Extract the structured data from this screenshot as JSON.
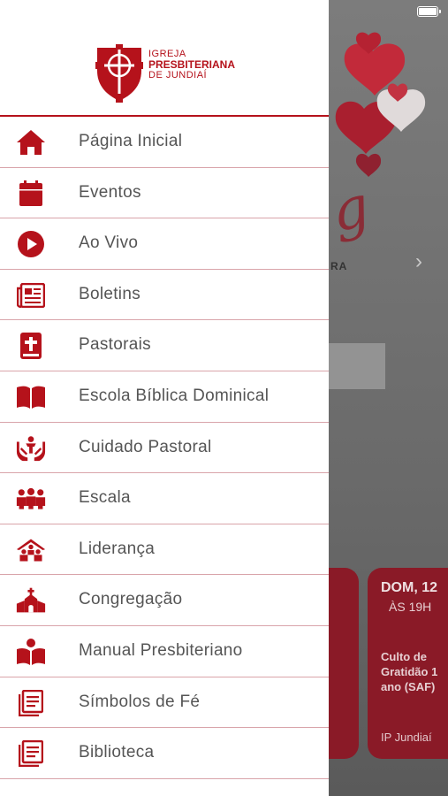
{
  "colors": {
    "accent": "#b5121b",
    "divider": "#d9a4aa",
    "label": "#555555"
  },
  "logo": {
    "line1": "IGREJA",
    "line2": "PRESBITERIANA",
    "line3": "DE JUNDIAÍ"
  },
  "menu": {
    "items": [
      {
        "label": "Página Inicial",
        "icon": "home-icon"
      },
      {
        "label": "Eventos",
        "icon": "calendar-icon"
      },
      {
        "label": "Ao Vivo",
        "icon": "play-circle-icon"
      },
      {
        "label": "Boletins",
        "icon": "newspaper-icon"
      },
      {
        "label": "Pastorais",
        "icon": "bible-icon"
      },
      {
        "label": "Escola Bíblica Dominical",
        "icon": "open-book-icon"
      },
      {
        "label": "Cuidado Pastoral",
        "icon": "hands-care-icon"
      },
      {
        "label": "Escala",
        "icon": "group-icon"
      },
      {
        "label": "Liderança",
        "icon": "leadership-icon"
      },
      {
        "label": "Congregação",
        "icon": "church-icon"
      },
      {
        "label": "Manual Presbiteriano",
        "icon": "reader-icon"
      },
      {
        "label": "Símbolos de Fé",
        "icon": "document-list-icon"
      },
      {
        "label": "Biblioteca",
        "icon": "library-icon"
      }
    ]
  },
  "background": {
    "event_card": {
      "date": "DOM, 12",
      "time": "ÀS 19H",
      "title": "Culto de Gratidão 1 ano (SAF)",
      "location": "IP Jundiaí"
    },
    "banner_fragment": "RA"
  }
}
